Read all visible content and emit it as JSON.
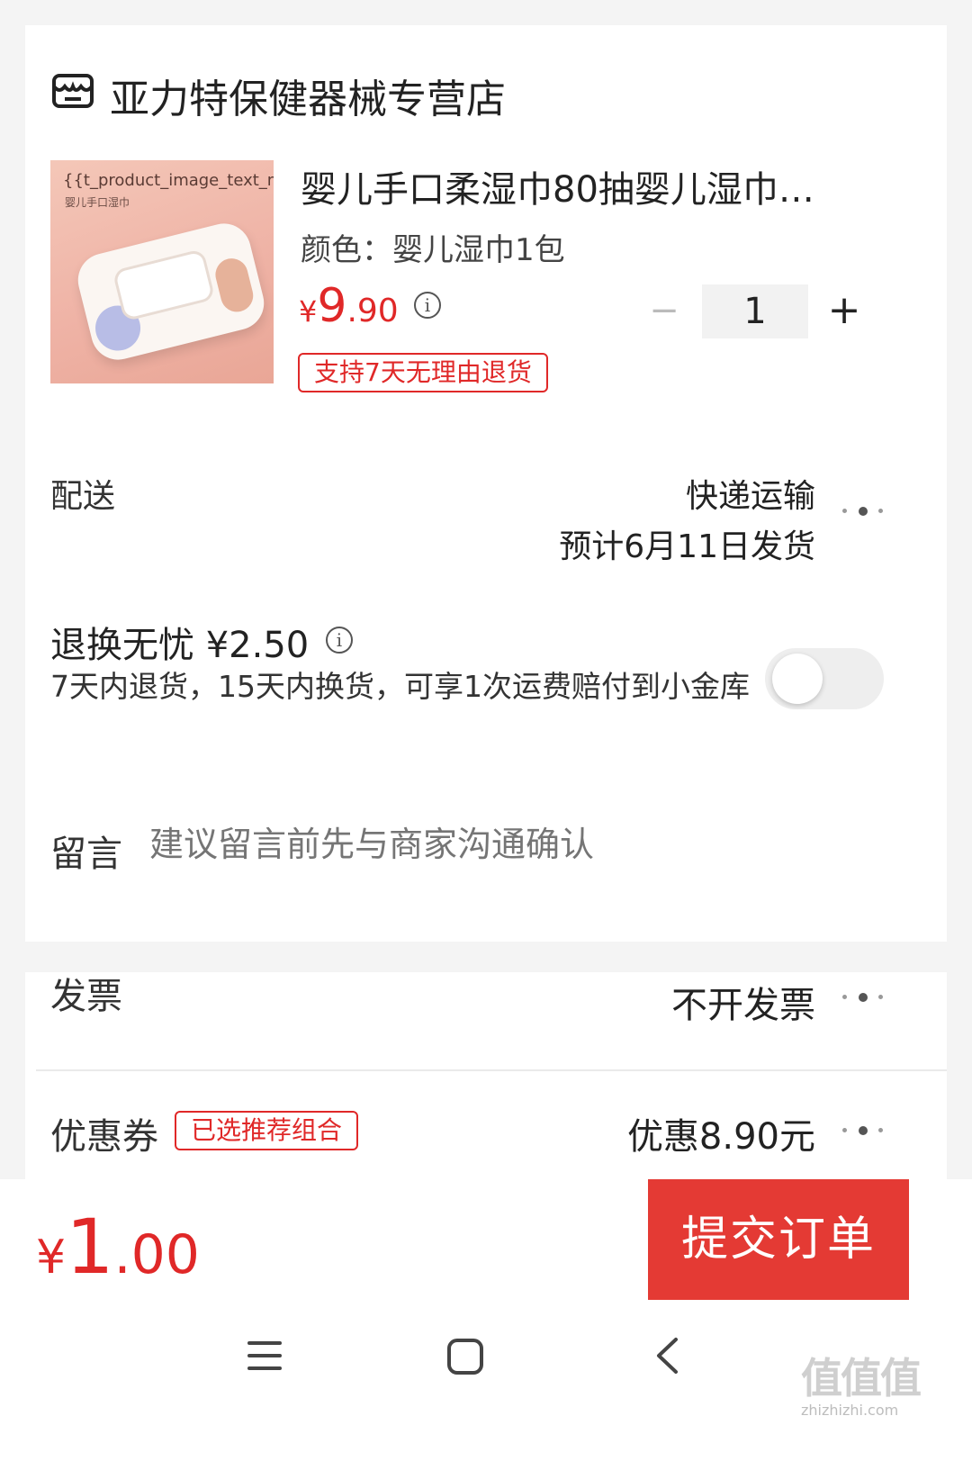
{
  "store": {
    "name": "亚力特保健器械专营店",
    "icon": "store-icon"
  },
  "product": {
    "image_text_main": "{{t_product_image_text_main}}",
    "image_text_sub": "婴儿手口湿巾",
    "title": "婴儿手口柔湿巾80抽婴儿湿巾…",
    "spec": "颜色：婴儿湿巾1包",
    "price": {
      "currency": "¥",
      "integer": "9",
      "decimal": ".90"
    },
    "price_info_icon": "info-icon",
    "quantity": "1",
    "minus_label": "−",
    "plus_label": "+",
    "return_badge": "支持7天无理由退货"
  },
  "delivery": {
    "label": "配送",
    "method": "快递运输",
    "eta": "预计6月11日发货",
    "more_icon": "more-dots-icon"
  },
  "return_insurance": {
    "title": "退换无忧 ¥2.50",
    "info_icon": "info-icon",
    "description": "7天内退货，15天内换货，可享1次运费赔付到小金库",
    "enabled": false
  },
  "message": {
    "label": "留言",
    "placeholder": "建议留言前先与商家沟通确认"
  },
  "invoice": {
    "label": "发票",
    "value": "不开发票",
    "more_icon": "more-dots-icon"
  },
  "coupon": {
    "label": "优惠券",
    "badge": "已选推荐组合",
    "value": "优惠8.90元",
    "more_icon": "more-dots-icon"
  },
  "footer": {
    "total": {
      "currency": "¥",
      "integer": "1",
      "decimal": ".00"
    },
    "submit_label": "提交订单"
  },
  "nav": {
    "menu_icon": "menu-icon",
    "home_icon": "home-square-icon",
    "back_icon": "back-chevron-icon"
  },
  "watermark": {
    "main": "值值值",
    "url": "zhizhizhi.com"
  },
  "colors": {
    "accent_red": "#e02828",
    "submit_bg": "#e43a34",
    "background": "#f4f4f4"
  }
}
